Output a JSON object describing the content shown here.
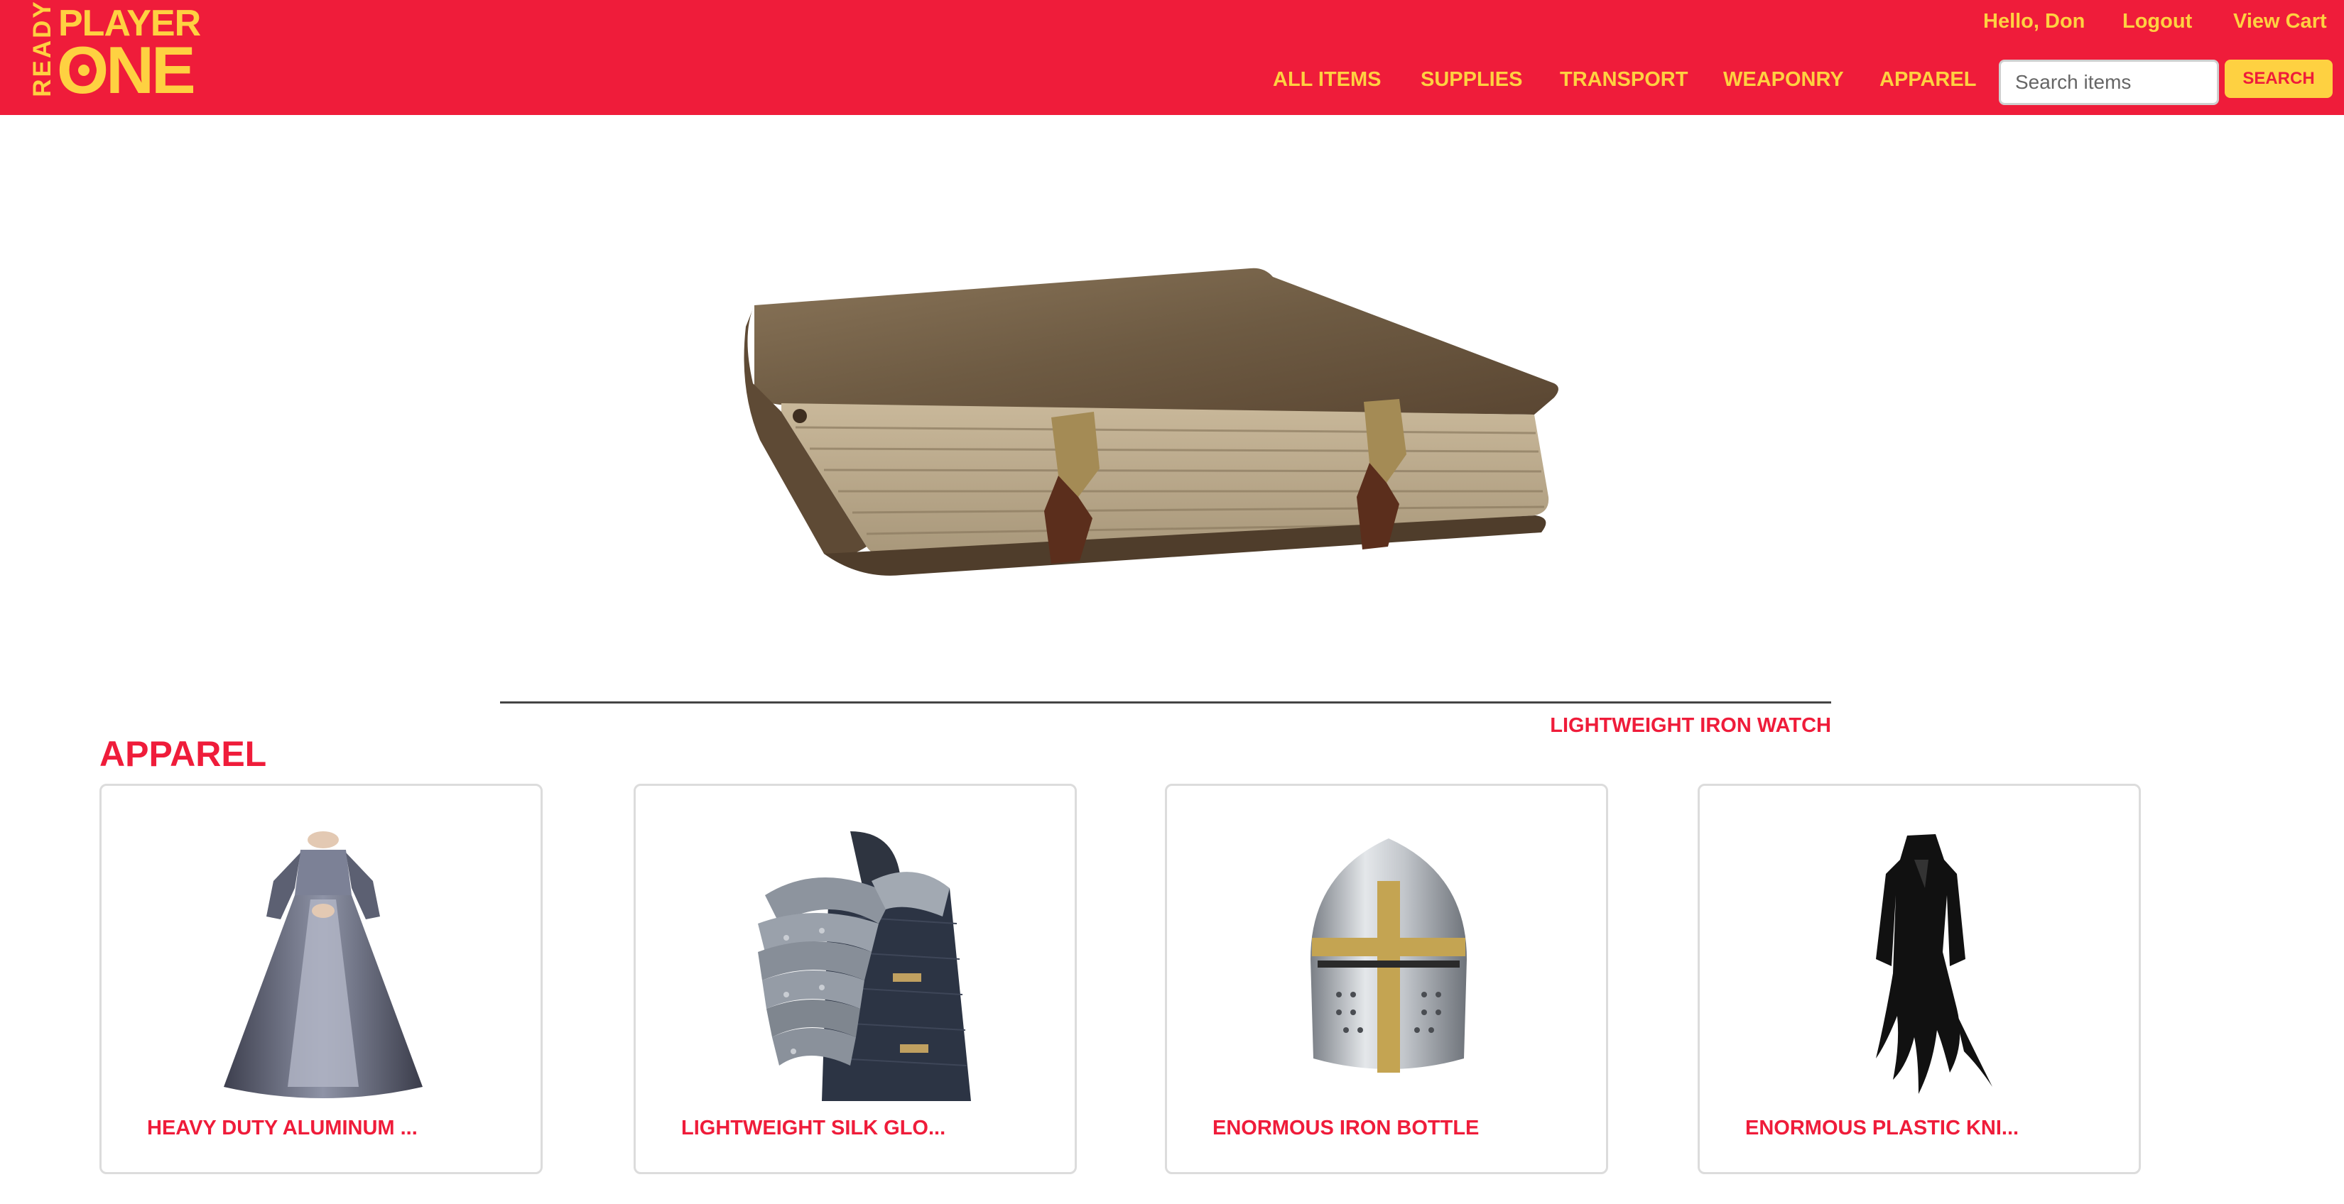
{
  "logo": {
    "ready": "READY",
    "player": "PLAYER",
    "one": "ONE"
  },
  "user": {
    "greeting": "Hello, Don",
    "logout": "Logout",
    "cart": "View Cart"
  },
  "nav": {
    "items": [
      "ALL ITEMS",
      "SUPPLIES",
      "TRANSPORT",
      "WEAPONRY",
      "APPAREL"
    ]
  },
  "search": {
    "placeholder": "Search items",
    "button": "SEARCH"
  },
  "hero": {
    "caption": "LIGHTWEIGHT IRON WATCH",
    "image": "antique-book"
  },
  "section": {
    "title": "APPAREL",
    "items": [
      {
        "name": "HEAVY DUTY ALUMINUM ...",
        "image": "ball-gown"
      },
      {
        "name": "LIGHTWEIGHT SILK GLO...",
        "image": "armor-pauldron"
      },
      {
        "name": "ENORMOUS IRON BOTTLE",
        "image": "knight-helmet"
      },
      {
        "name": "ENORMOUS PLASTIC KNI...",
        "image": "black-dress"
      }
    ]
  },
  "colors": {
    "brand_red": "#ef1c3a",
    "brand_yellow": "#fed141"
  }
}
